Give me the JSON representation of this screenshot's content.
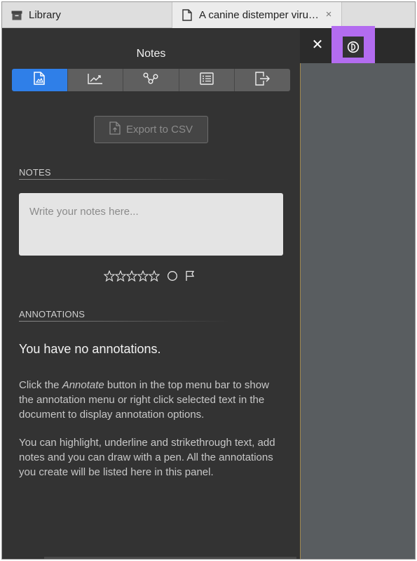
{
  "tabs": [
    {
      "title": "Library",
      "icon": "archive-icon"
    },
    {
      "title": "A canine distemper viru…",
      "icon": "document-icon",
      "close": "×"
    }
  ],
  "panel": {
    "title": "Notes",
    "toolbar": [
      {
        "name": "annotations-view",
        "icon": "document-image-icon",
        "active": true
      },
      {
        "name": "chart-view",
        "icon": "trend-chart-icon",
        "active": false
      },
      {
        "name": "graph-view",
        "icon": "share-nodes-icon",
        "active": false
      },
      {
        "name": "list-view",
        "icon": "list-icon",
        "active": false
      },
      {
        "name": "export-view",
        "icon": "file-export-icon",
        "active": false
      }
    ],
    "export_label": "Export to CSV",
    "notes_heading": "NOTES",
    "notes_placeholder": "Write your notes here...",
    "rating": {
      "stars": 5,
      "filled": 0
    },
    "annotations_heading": "ANNOTATIONS",
    "no_annotations": "You have no annotations.",
    "help_p1_a": "Click the ",
    "help_p1_em": "Annotate",
    "help_p1_b": " button in the top menu bar to show the annotation menu or right click selected text in the document to display annotation options.",
    "help_p2": "You can highlight, underline and strikethrough text, add notes and you can draw with a pen. All the annotations you create will be listed here in this panel."
  },
  "right": {
    "close_label": "✕",
    "accent": "#b36cf0"
  },
  "colors": {
    "panel_bg": "#333333",
    "active_tab": "#2f7fe8",
    "doc_bg": "#595d60"
  }
}
